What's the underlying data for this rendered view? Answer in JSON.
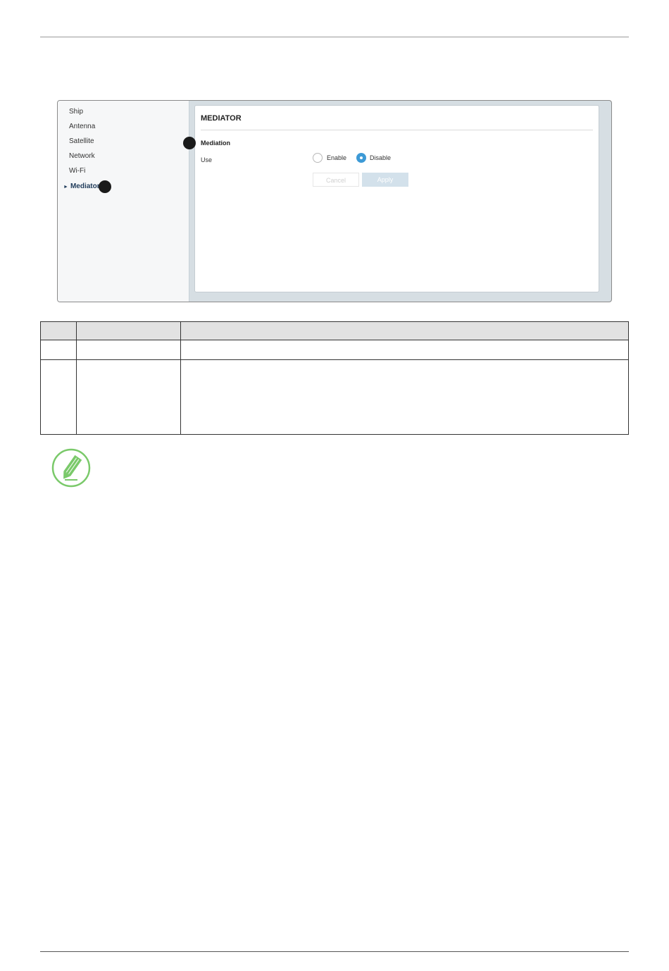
{
  "ui": {
    "sidebar": {
      "items": [
        {
          "label": "Ship"
        },
        {
          "label": "Antenna"
        },
        {
          "label": "Satellite"
        },
        {
          "label": "Network"
        },
        {
          "label": "Wi-Fi"
        },
        {
          "label": "Mediator",
          "active": true
        }
      ]
    },
    "panel": {
      "title": "MEDIATOR",
      "section": "Mediation",
      "use_label": "Use",
      "options": [
        {
          "label": "Enable",
          "selected": false
        },
        {
          "label": "Disable",
          "selected": true
        }
      ],
      "cancel_label": "Cancel",
      "apply_label": "Apply"
    }
  },
  "colors": {
    "accent": "#3d9ad6",
    "active_nav": "#1f3b5a",
    "note_icon": "#7ac96a"
  },
  "icons": {
    "note": "pencil-note-icon"
  }
}
